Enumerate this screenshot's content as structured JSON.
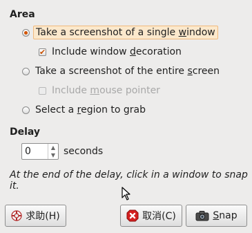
{
  "area": {
    "title": "Area",
    "options": [
      {
        "label": "Take a screenshot of a single window",
        "selected": true
      },
      {
        "label": "Take a screenshot of the entire screen",
        "selected": false
      },
      {
        "label": "Select a region to grab",
        "selected": false
      }
    ],
    "include_decoration": {
      "label": "Include window decoration",
      "checked": true
    },
    "include_pointer": {
      "label": "Include mouse pointer",
      "checked": false,
      "enabled": false
    }
  },
  "delay": {
    "title": "Delay",
    "value": "0",
    "unit": "seconds"
  },
  "hint": "At the end of the delay, click in a window to snap it.",
  "buttons": {
    "help": "求助(H)",
    "cancel": "取消(C)",
    "snap": "Snap"
  },
  "colors": {
    "accent": "#d35400",
    "background": "#edeceb"
  }
}
